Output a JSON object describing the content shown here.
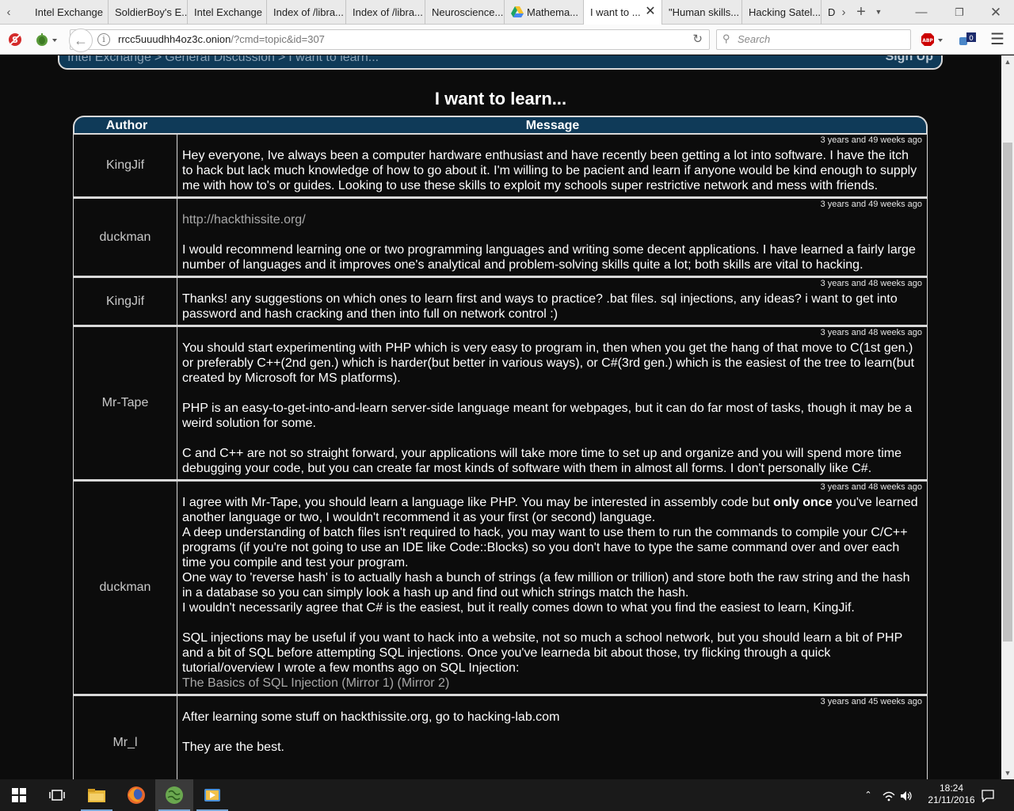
{
  "browser": {
    "tabs": [
      {
        "label": "Intel Exchange"
      },
      {
        "label": "SoldierBoy's E..."
      },
      {
        "label": "Intel Exchange"
      },
      {
        "label": "Index of /libra..."
      },
      {
        "label": "Index of /libra..."
      },
      {
        "label": "Neuroscience..."
      },
      {
        "label": "Mathema..."
      },
      {
        "label": "I want to ..."
      },
      {
        "label": "\"Human skills..."
      },
      {
        "label": "Hacking Satel..."
      },
      {
        "label": "D"
      }
    ],
    "active_tab_index": 7,
    "url_host": "rrcc5uuudhh4oz3c.onion",
    "url_path": "/?cmd=topic&id=307",
    "search_placeholder": "Search",
    "adblock_badge": "ABP",
    "notification_count": "0"
  },
  "site": {
    "breadcrumbs": [
      "Intel Exchange",
      "General Discussion",
      "I want to learn..."
    ],
    "breadcrumb_separator": ">",
    "signup_label": "Sign Up"
  },
  "topic": {
    "title": "I want to learn...",
    "col_author": "Author",
    "col_message": "Message"
  },
  "posts": [
    {
      "author": "KingJif",
      "time": "3 years and 49 weeks ago",
      "paragraphs": [
        "Hey everyone, Ive always been a computer hardware enthusiast and have recently been getting a lot into software. I have the itch to hack but lack much knowledge of how to go about it. I'm willing to be pacient and learn if anyone would be kind enough to supply me with how to's or guides. Looking to use these skills to exploit my schools super restrictive network and mess with friends."
      ]
    },
    {
      "author": "duckman",
      "time": "3 years and 49 weeks ago",
      "link": "http://hackthissite.org/",
      "paragraphs": [
        "I would recommend learning one or two programming languages and writing some decent applications. I have learned a fairly large number of languages and it improves one's analytical and problem-solving skills quite a lot; both skills are vital to hacking."
      ]
    },
    {
      "author": "KingJif",
      "time": "3 years and 48 weeks ago",
      "paragraphs": [
        "Thanks! any suggestions on which ones to learn first and ways to practice? .bat files. sql injections, any ideas? i want to get into password and hash cracking and then into full on network control :)"
      ]
    },
    {
      "author": "Mr-Tape",
      "time": "3 years and 48 weeks ago",
      "paragraphs": [
        "You should start experimenting with PHP which is very easy to program in, then when you get the hang of that move to C(1st gen.) or preferably C++(2nd gen.) which is harder(but better in various ways), or C#(3rd gen.) which is the easiest of the tree to learn(but created by Microsoft for MS platforms).",
        "PHP is an easy-to-get-into-and-learn server-side language meant for webpages, but it can do far most of tasks, though it may be a weird solution for some.",
        "C and C++ are not so straight forward, your applications will take more time to set up and organize and you will spend more time debugging your code, but you can create far most kinds of software with them in almost all forms. I don't personally like C#."
      ]
    },
    {
      "author": "duckman",
      "time": "3 years and 48 weeks ago",
      "p1_before": "I agree with Mr-Tape, you should learn a language like PHP. You may be interested in assembly code but ",
      "p1_bold": "only once",
      "p1_after": " you've learned another language or two, I wouldn't recommend it as your first (or second) language.",
      "p2": "A deep understanding of batch files isn't required to hack, you may want to use them to run the commands to compile your C/C++ programs (if you're not going to use an IDE like Code::Blocks) so you don't have to type the same command over and over each time you compile and test your program.",
      "p3": "One way to 'reverse hash' is to actually hash a bunch of strings (a few million or trillion) and store both the raw string and the hash in a database so you can simply look a hash up and find out which strings match the hash.",
      "p4": "I wouldn't necessarily agree that C# is the easiest, but it really comes down to what you find the easiest to learn, KingJif.",
      "p5": "SQL injections may be useful if you want to hack into a website, not so much a school network, but you should learn a bit of PHP and a bit of SQL before attempting SQL injections. Once you've learneda bit about those, try flicking through a quick tutorial/overview I wrote a few months ago on SQL Injection:",
      "link1": "The Basics of SQL Injection",
      "link2": "(Mirror 1)",
      "link3": "(Mirror 2)"
    },
    {
      "author": "Mr_l",
      "time": "3 years and 45 weeks ago",
      "paragraphs": [
        "After learning some stuff on hackthissite.org, go to hacking-lab.com",
        "They are the best."
      ]
    }
  ],
  "taskbar": {
    "time": "18:24",
    "date": "21/11/2016"
  }
}
